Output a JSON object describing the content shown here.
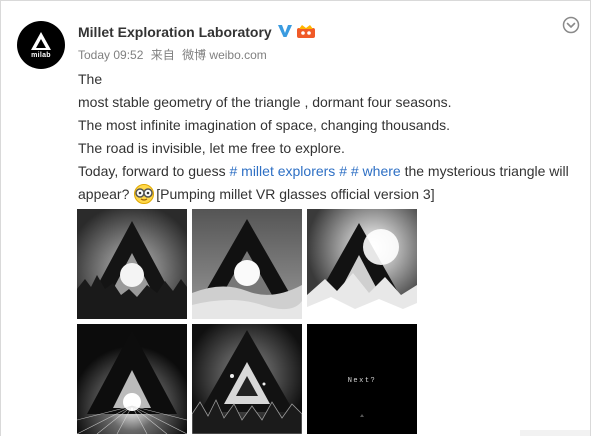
{
  "post": {
    "author": "Millet Exploration Laboratory",
    "avatar_text": "milab",
    "verified_icon": "verified-v-icon",
    "vip_icon": "vip-crown-icon",
    "time": "Today 09:52",
    "source_prefix": "来自",
    "source": "微博 weibo.com",
    "follow_icon": "chevron-down-circle-icon",
    "lines": {
      "l1": "The",
      "l2": "most stable geometry of the triangle , dormant four seasons.",
      "l3": "The most infinite imagination of space, changing thousands.",
      "l4": "The road is invisible, let me free to explore.",
      "l5_a": "Today, forward to guess ",
      "l5_topic1": "# millet explorers #",
      "l5_sp": " ",
      "l5_topic2": "# where",
      "l5_b": " the mysterious triangle will appear? ",
      "l5_emoji": "vr-glasses-emoji-icon",
      "l5_c": "[Pumping millet VR glasses official version 3]"
    },
    "accent_color": "#2d6fc4",
    "images": [
      {
        "name": "triangle-forest-sun-image"
      },
      {
        "name": "triangle-sun-dunes-image"
      },
      {
        "name": "triangle-snowy-mountain-image"
      },
      {
        "name": "triangle-light-rays-image"
      },
      {
        "name": "triangle-rocky-terrain-image"
      },
      {
        "name": "next-teaser-image",
        "text": "Next?"
      }
    ]
  }
}
